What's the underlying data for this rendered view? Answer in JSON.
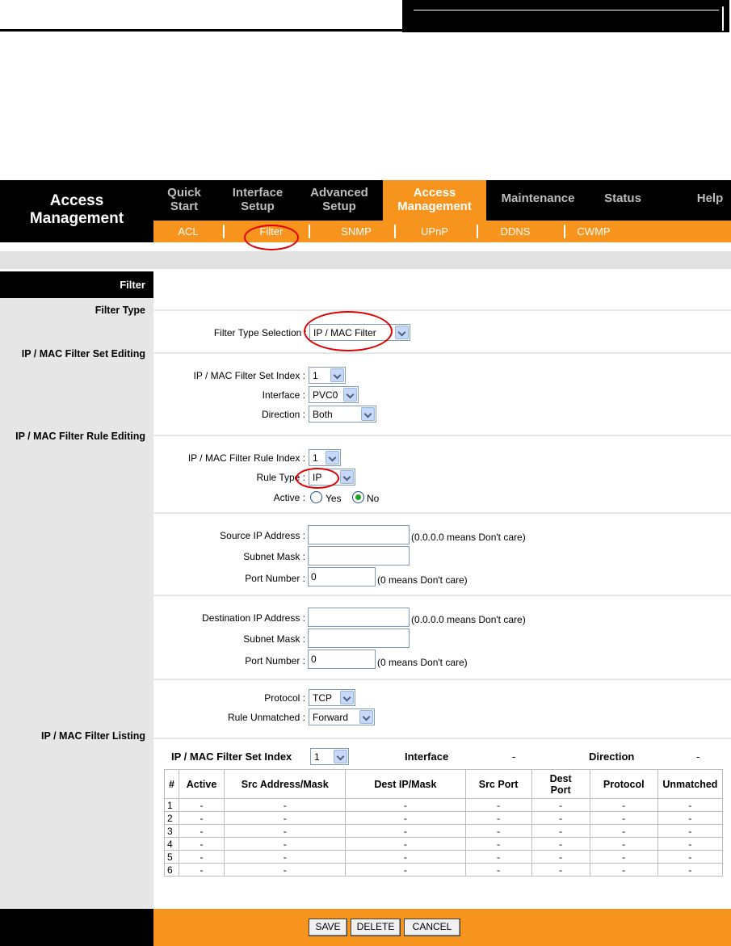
{
  "brand": {
    "line1": "Access",
    "line2": "Management"
  },
  "menu": [
    {
      "label": "Quick\nStart",
      "active": false
    },
    {
      "label": "Interface\nSetup",
      "active": false
    },
    {
      "label": "Advanced\nSetup",
      "active": false
    },
    {
      "label": "Access\nManagement",
      "active": true
    },
    {
      "label": "Maintenance",
      "active": false
    },
    {
      "label": "Status",
      "active": false
    },
    {
      "label": "Help",
      "active": false
    }
  ],
  "submenu": [
    "ACL",
    "Filter",
    "SNMP",
    "UPnP",
    "DDNS",
    "CWMP"
  ],
  "submenu_active": "Filter",
  "section_title": "Filter",
  "left_labels": {
    "filter_type": "Filter Type",
    "set_editing": "IP / MAC Filter Set Editing",
    "rule_editing": "IP / MAC Filter Rule Editing",
    "listing": "IP / MAC Filter Listing"
  },
  "form": {
    "filter_type_selection": {
      "label": "Filter Type Selection :",
      "value": "IP / MAC Filter"
    },
    "set_index": {
      "label": "IP / MAC Filter Set Index :",
      "value": "1"
    },
    "interface": {
      "label": "Interface :",
      "value": "PVC0"
    },
    "direction": {
      "label": "Direction :",
      "value": "Both"
    },
    "rule_index": {
      "label": "IP / MAC Filter Rule Index :",
      "value": "1"
    },
    "rule_type": {
      "label": "Rule Type :",
      "value": "IP"
    },
    "active": {
      "label": "Active :",
      "yes": "Yes",
      "no": "No",
      "selected": "No"
    },
    "source_ip": {
      "label": "Source IP Address :",
      "value": "",
      "hint": "(0.0.0.0 means Don't care)"
    },
    "source_mask": {
      "label": "Subnet Mask :",
      "value": ""
    },
    "source_port": {
      "label": "Port Number :",
      "value": "0",
      "hint": "(0 means Don't care)"
    },
    "dest_ip": {
      "label": "Destination IP Address :",
      "value": "",
      "hint": "(0.0.0.0 means Don't care)"
    },
    "dest_mask": {
      "label": "Subnet Mask :",
      "value": ""
    },
    "dest_port": {
      "label": "Port Number :",
      "value": "0",
      "hint": "(0 means Don't care)"
    },
    "protocol": {
      "label": "Protocol :",
      "value": "TCP"
    },
    "rule_unmatched": {
      "label": "Rule Unmatched :",
      "value": "Forward"
    }
  },
  "listing": {
    "set_index_label": "IP / MAC Filter Set Index",
    "set_index_value": "1",
    "interface_label": "Interface",
    "interface_value": "-",
    "direction_label": "Direction",
    "direction_value": "-",
    "columns": [
      "#",
      "Active",
      "Src Address/Mask",
      "Dest IP/Mask",
      "Src Port",
      "Dest\nPort",
      "Protocol",
      "Unmatched"
    ],
    "rows": [
      [
        "1",
        "-",
        "-",
        "-",
        "-",
        "-",
        "-",
        "-"
      ],
      [
        "2",
        "-",
        "-",
        "-",
        "-",
        "-",
        "-",
        "-"
      ],
      [
        "3",
        "-",
        "-",
        "-",
        "-",
        "-",
        "-",
        "-"
      ],
      [
        "4",
        "-",
        "-",
        "-",
        "-",
        "-",
        "-",
        "-"
      ],
      [
        "5",
        "-",
        "-",
        "-",
        "-",
        "-",
        "-",
        "-"
      ],
      [
        "6",
        "-",
        "-",
        "-",
        "-",
        "-",
        "-",
        "-"
      ]
    ]
  },
  "buttons": {
    "save": "SAVE",
    "delete": "DELETE",
    "cancel": "CANCEL"
  },
  "colors": {
    "accent": "#f7941d",
    "highlight_ring": "#e00000",
    "radio_selected": "#21a121"
  }
}
